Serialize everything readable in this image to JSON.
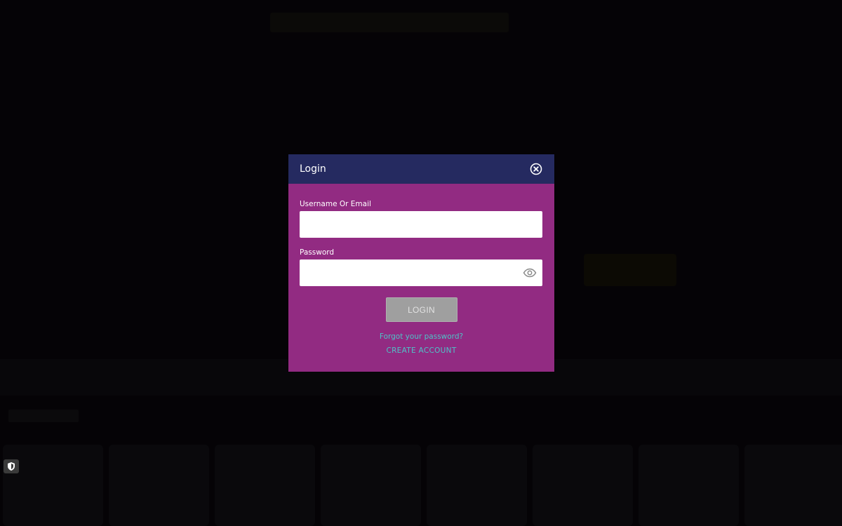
{
  "modal": {
    "title": "Login",
    "username_label": "Username Or Email",
    "username_value": "",
    "password_label": "Password",
    "password_value": "",
    "login_label": "LOGIN",
    "forgot_label": "Forgot your password?",
    "create_account_label": "CREATE ACCOUNT"
  },
  "icons": {
    "close": "close-circle-icon",
    "password_visibility": "eye-icon",
    "privacy": "shield-icon"
  },
  "colors": {
    "header_bg": "#252a60",
    "body_bg": "#922b82",
    "link": "#4ec3c8",
    "login_button_bg": "#9f9f9f",
    "overlay_bg": "#050306"
  }
}
